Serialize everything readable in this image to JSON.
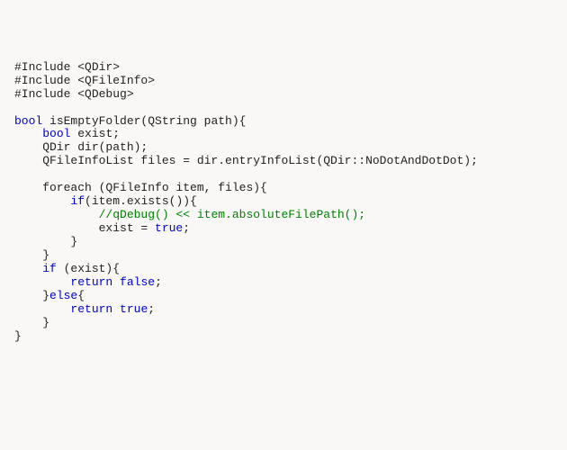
{
  "code": {
    "l1a": "#Include <QDir>",
    "l2a": "#Include <QFileInfo>",
    "l3a": "#Include <QDebug>",
    "l5a": "bool",
    "l5b": " isEmptyFolder(QString path){",
    "l6a": "    ",
    "l6b": "bool",
    "l6c": " exist;",
    "l7a": "    QDir dir(path);",
    "l8a": "    QFileInfoList files = dir.entryInfoList(QDir::NoDotAndDotDot);",
    "l10a": "    foreach (QFileInfo item, files){",
    "l11a": "        ",
    "l11b": "if",
    "l11c": "(item.exists()){",
    "l12a": "            ",
    "l12b": "//qDebug() << item.absoluteFilePath();",
    "l13a": "            exist = ",
    "l13b": "true",
    "l13c": ";",
    "l14a": "        }",
    "l15a": "    }",
    "l16a": "    ",
    "l16b": "if",
    "l16c": " (exist){",
    "l17a": "        ",
    "l17b": "return",
    "l17c": " ",
    "l17d": "false",
    "l17e": ";",
    "l18a": "    }",
    "l18b": "else",
    "l18c": "{",
    "l19a": "        ",
    "l19b": "return",
    "l19c": " ",
    "l19d": "true",
    "l19e": ";",
    "l20a": "    }",
    "l21a": "}"
  }
}
